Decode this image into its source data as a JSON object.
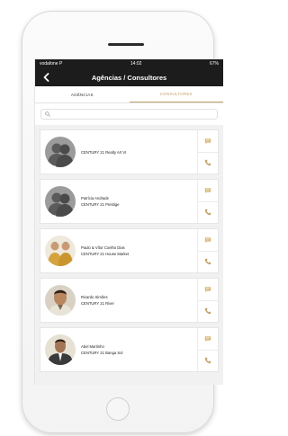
{
  "status_bar": {
    "carrier": "vodafone P",
    "time": "14:02",
    "battery": "67%"
  },
  "nav": {
    "title": "Agências / Consultores"
  },
  "tabs": [
    {
      "label": "AGÊNCIAS"
    },
    {
      "label": "CONSULTORES"
    }
  ],
  "search": {
    "placeholder": "",
    "value": ""
  },
  "agents": [
    {
      "name": "",
      "agency": "CENTURY 21 Realty Art VI",
      "avatar": "placeholder-silhouette"
    },
    {
      "name": "Patrícia Andrade",
      "agency": "CENTURY 21 Prestige",
      "avatar": "placeholder-silhouette"
    },
    {
      "name": "Paulo & Vítor Coelho Dias",
      "agency": "CENTURY 21 House Market",
      "avatar": "two-people-photo"
    },
    {
      "name": "Ricardo Simões",
      "agency": "CENTURY 21 River",
      "avatar": "person-photo"
    },
    {
      "name": "Abel Martinho",
      "agency": "CENTURY 21 Banga Sol",
      "avatar": "person-photo"
    }
  ],
  "actions": {
    "message_icon": "chat-bubble-icon",
    "call_icon": "phone-icon"
  },
  "colors": {
    "nav_bg": "#1c1c1c",
    "accent": "#c4a36b",
    "list_bg": "#f1f1f1"
  }
}
